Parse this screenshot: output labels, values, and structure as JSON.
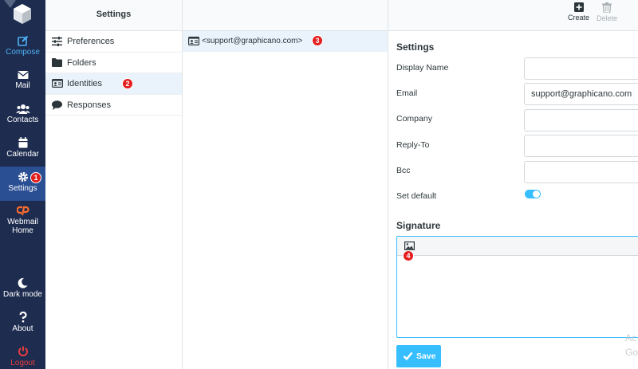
{
  "nav": {
    "items": [
      {
        "label": "Compose"
      },
      {
        "label": "Mail"
      },
      {
        "label": "Contacts"
      },
      {
        "label": "Calendar"
      },
      {
        "label": "Settings"
      },
      {
        "label": "Webmail",
        "label2": "Home"
      },
      {
        "label": "Dark mode"
      },
      {
        "label": "About"
      },
      {
        "label": "Logout"
      }
    ],
    "colors": {
      "background": "#1d2c4f",
      "active": "#2b4f93",
      "compose": "#4fb2f5",
      "logout": "#e63d3d"
    }
  },
  "settings_list": {
    "title": "Settings",
    "items": [
      {
        "label": "Preferences",
        "icon": "sliders-icon"
      },
      {
        "label": "Folders",
        "icon": "folder-icon"
      },
      {
        "label": "Identities",
        "icon": "id-card-icon",
        "selected": true
      },
      {
        "label": "Responses",
        "icon": "comment-icon"
      }
    ]
  },
  "identities": {
    "items": [
      {
        "label": "<support@graphicano.com>",
        "icon": "id-card-icon"
      }
    ]
  },
  "toolbar": {
    "create_label": "Create",
    "delete_label": "Delete"
  },
  "form": {
    "title": "Settings",
    "fields": [
      {
        "label": "Display Name",
        "value": ""
      },
      {
        "label": "Email",
        "value": "support@graphicano.com"
      },
      {
        "label": "Company",
        "value": ""
      },
      {
        "label": "Reply-To",
        "value": ""
      },
      {
        "label": "Bcc",
        "value": ""
      }
    ],
    "set_default_label": "Set default",
    "set_default_on": true,
    "signature_title": "Signature",
    "save_label": "Save"
  },
  "badges": [
    "1",
    "2",
    "3",
    "4"
  ],
  "watermark": {
    "line1": "Ac",
    "line2": "Go"
  },
  "accent": "#37beff"
}
